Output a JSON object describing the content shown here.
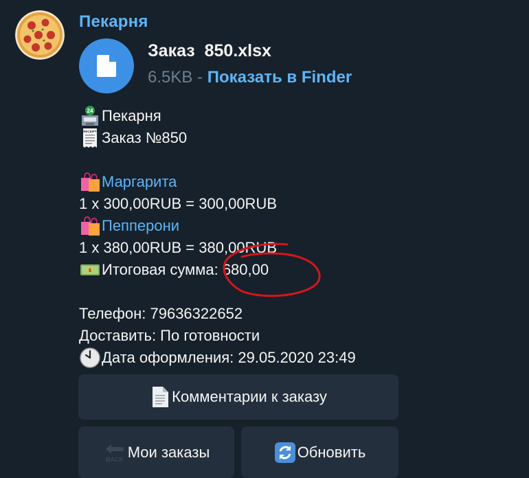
{
  "sender_name": "Пекарня",
  "file": {
    "name": "Заказ  850.xlsx",
    "size": "6.5KB",
    "separator": " - ",
    "action_label": "Показать в Finder"
  },
  "message": {
    "shop": "Пекарня",
    "order": "Заказ №850",
    "item1_name": "Маргарита",
    "item1_line": "1 x 300,00RUB = 300,00RUB",
    "item2_name": "Пепперони",
    "item2_line": "1 x 380,00RUB = 380,00RUB",
    "total": "Итоговая сумма: 680,00",
    "phone": "Телефон: 79636322652",
    "delivery": "Доставить: По готовности",
    "date": "Дата оформления: 29.05.2020 23:49"
  },
  "buttons": {
    "comments": "Комментарии к заказу",
    "my_orders": "Мои заказы",
    "refresh": "Обновить"
  },
  "emoji_texts": {
    "atm_number": "24",
    "receipt_label": "RECEIPT",
    "back_label": "BACK"
  },
  "colors": {
    "background": "#17212b",
    "accent": "#5eb5f7",
    "file_icon": "#3c91e6",
    "button_bg": "#232f3d",
    "annotation": "#d9141c"
  },
  "icons": [
    "pizza-avatar",
    "file-icon",
    "atm-icon",
    "receipt-icon",
    "shopping-bags-icon",
    "money-icon",
    "clock-icon",
    "page-icon",
    "back-icon",
    "refresh-icon"
  ]
}
